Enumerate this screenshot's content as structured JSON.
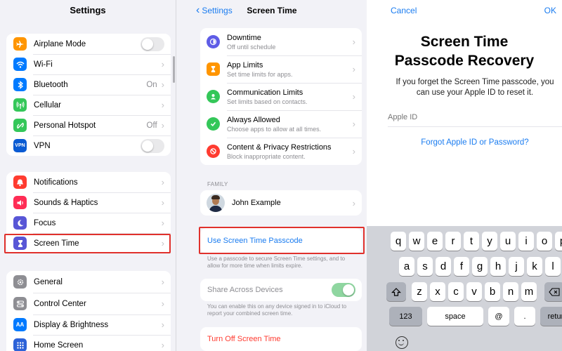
{
  "settings": {
    "title": "Settings",
    "group1": [
      {
        "label": "Airplane Mode",
        "icon": "airplane-icon",
        "color": "#ff9500",
        "control": "toggle",
        "on": false
      },
      {
        "label": "Wi-Fi",
        "icon": "wifi-icon",
        "color": "#007aff",
        "control": "chevron"
      },
      {
        "label": "Bluetooth",
        "icon": "bluetooth-icon",
        "color": "#007aff",
        "value": "On",
        "control": "chevron"
      },
      {
        "label": "Cellular",
        "icon": "cellular-icon",
        "color": "#34c759",
        "control": "chevron"
      },
      {
        "label": "Personal Hotspot",
        "icon": "hotspot-icon",
        "color": "#34c759",
        "value": "Off",
        "control": "chevron"
      },
      {
        "label": "VPN",
        "icon": "vpn-icon",
        "color": "#0a5bd3",
        "badge": "VPN",
        "control": "toggle",
        "on": false
      }
    ],
    "group2": [
      {
        "label": "Notifications",
        "icon": "bell-icon",
        "color": "#ff3b30"
      },
      {
        "label": "Sounds & Haptics",
        "icon": "speaker-icon",
        "color": "#ff2d55"
      },
      {
        "label": "Focus",
        "icon": "moon-icon",
        "color": "#5856d6"
      },
      {
        "label": "Screen Time",
        "icon": "hourglass-icon",
        "color": "#5856d6"
      }
    ],
    "group3": [
      {
        "label": "General",
        "icon": "gear-icon",
        "color": "#8e8e93"
      },
      {
        "label": "Control Center",
        "icon": "switches-icon",
        "color": "#8e8e93"
      },
      {
        "label": "Display & Brightness",
        "icon": "display-icon",
        "color": "#007aff",
        "badge": "AA"
      },
      {
        "label": "Home Screen",
        "icon": "grid-icon",
        "color": "#2c62d8"
      }
    ]
  },
  "screen_time": {
    "back_label": "Settings",
    "title": "Screen Time",
    "items": [
      {
        "title": "Downtime",
        "subtitle": "Off until schedule",
        "icon": "downtime-icon",
        "color": "#5e5ce6"
      },
      {
        "title": "App Limits",
        "subtitle": "Set time limits for apps.",
        "icon": "hourglass-icon",
        "color": "#ff9500"
      },
      {
        "title": "Communication Limits",
        "subtitle": "Set limits based on contacts.",
        "icon": "contacts-icon",
        "color": "#34c759"
      },
      {
        "title": "Always Allowed",
        "subtitle": "Choose apps to allow at all times.",
        "icon": "checkmark-icon",
        "color": "#34c759"
      },
      {
        "title": "Content & Privacy Restrictions",
        "subtitle": "Block inappropriate content.",
        "icon": "restriction-icon",
        "color": "#ff3b30"
      }
    ],
    "family_header": "FAMILY",
    "family_member": "John Example",
    "passcode_label": "Use Screen Time Passcode",
    "passcode_footer": "Use a passcode to secure Screen Time settings, and to allow for more time when limits expire.",
    "share_label": "Share Across Devices",
    "share_on": true,
    "share_footer": "You can enable this on any device signed in to iCloud to report your combined screen time.",
    "turn_off_label": "Turn Off Screen Time"
  },
  "recovery": {
    "cancel_label": "Cancel",
    "ok_label": "OK",
    "title_line1": "Screen Time",
    "title_line2": "Passcode Recovery",
    "desc_line1": "If you forget the Screen Time passcode, you",
    "desc_line2": "can use your Apple ID to reset it.",
    "appleid_placeholder": "Apple ID",
    "forgot_label": "Forgot Apple ID or Password?",
    "keyboard": {
      "row1": [
        "q",
        "w",
        "e",
        "r",
        "t",
        "y",
        "u",
        "i",
        "o",
        "p"
      ],
      "row2": [
        "a",
        "s",
        "d",
        "f",
        "g",
        "h",
        "j",
        "k",
        "l"
      ],
      "row3": [
        "z",
        "x",
        "c",
        "v",
        "b",
        "n",
        "m"
      ],
      "numbers_key": "123",
      "space_key": "space",
      "at_key": "@",
      "dot_key": ".",
      "return_key": "return",
      "shift_icon": "shift-icon",
      "delete_icon": "delete-icon",
      "emoji_icon": "emoji-icon"
    }
  }
}
